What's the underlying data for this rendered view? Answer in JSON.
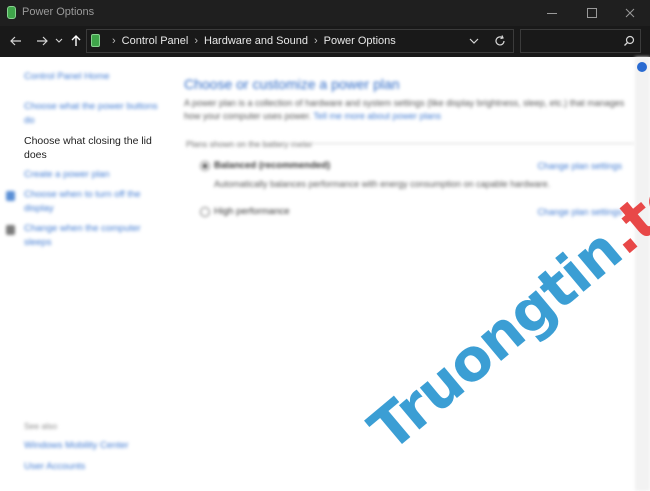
{
  "window": {
    "title": "Power Options",
    "controls": {
      "minimize": "minimize-icon",
      "maximize": "maximize-icon",
      "close": "close-icon"
    }
  },
  "address_bar": {
    "breadcrumbs": [
      "Control Panel",
      "Hardware and Sound",
      "Power Options"
    ],
    "search_value": ""
  },
  "sidebar": {
    "items": [
      {
        "label": "Control Panel Home"
      },
      {
        "label": "Choose what the power buttons do"
      },
      {
        "label": "Choose what closing the lid does"
      },
      {
        "label": "Create a power plan"
      },
      {
        "label": "Choose when to turn off the display"
      },
      {
        "label": "Change when the computer sleeps"
      }
    ],
    "see_also_heading": "See also",
    "see_also": [
      {
        "label": "Windows Mobility Center"
      },
      {
        "label": "User Accounts"
      }
    ]
  },
  "main": {
    "title": "Choose or customize a power plan",
    "description": "A power plan is a collection of hardware and system settings (like display brightness, sleep, etc.) that manages how your computer uses power.",
    "description_link": "Tell me more about power plans",
    "section_header": "Plans shown on the battery meter",
    "plans": [
      {
        "name": "Balanced (recommended)",
        "selected": true,
        "description": "Automatically balances performance with energy consumption on capable hardware.",
        "link": "Change plan settings"
      },
      {
        "name": "High performance",
        "selected": false,
        "link": "Change plan settings"
      }
    ]
  },
  "watermark": {
    "part1": "Truongtin",
    "part2": ".top"
  },
  "colors": {
    "titlebar": "#1f1f1f",
    "link": "#3f7ad2",
    "heading": "#2f6bc7",
    "accent_green": "#3fa54a",
    "watermark_blue": "#3b9ed4",
    "watermark_red": "#e84848"
  }
}
